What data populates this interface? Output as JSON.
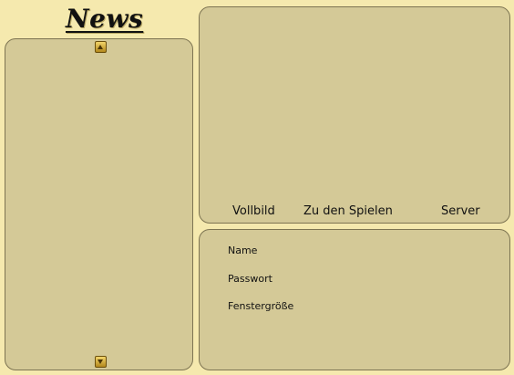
{
  "header": {
    "title": "News"
  },
  "news_panel": {
    "scroll_up_icon": "triangle-up",
    "scroll_down_icon": "triangle-down"
  },
  "nav": {
    "fullscreen_label": "Vollbild",
    "games_label": "Zu den Spielen",
    "server_label": "Server"
  },
  "login": {
    "name_label": "Name",
    "password_label": "Passwort",
    "window_size_label": "Fenstergröße"
  },
  "colors": {
    "background": "#f5e9ae",
    "panel": "#d4c997",
    "panel_border": "#7d7452",
    "scroll_button": "#d4a935"
  }
}
